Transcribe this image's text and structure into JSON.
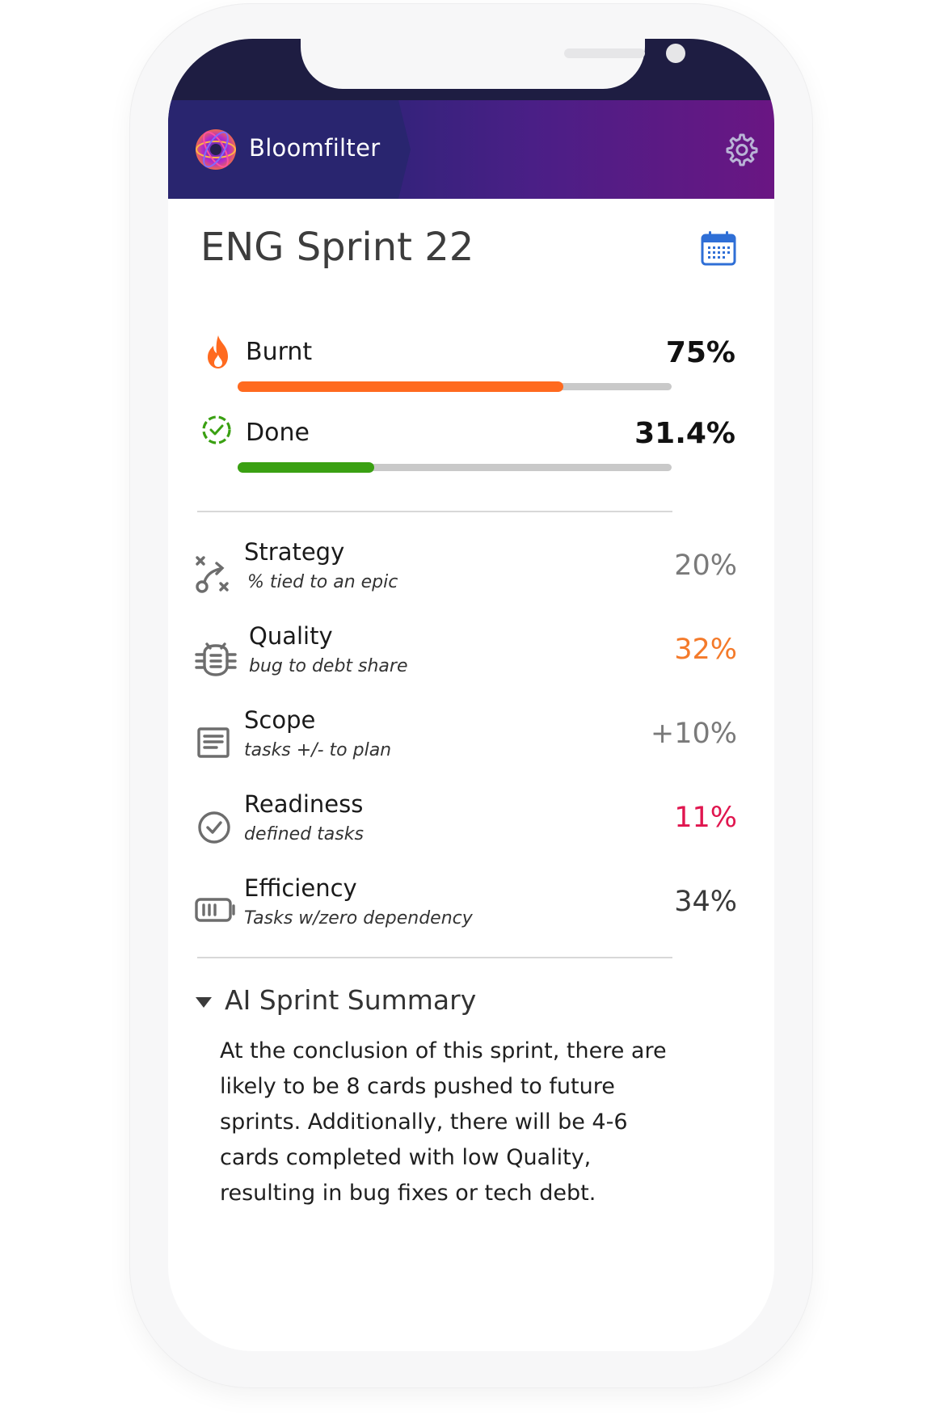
{
  "app": {
    "brand": "Bloomfilter"
  },
  "sprint": {
    "title": "ENG Sprint 22"
  },
  "progress": {
    "burnt": {
      "label": "Burnt",
      "value": "75%",
      "fraction": 0.75,
      "color": "#ff6a1f",
      "icon": "flame-icon"
    },
    "done": {
      "label": "Done",
      "value": "31.4%",
      "fraction": 0.314,
      "color": "#3aa012",
      "icon": "dashed-check-circle-icon"
    }
  },
  "metrics": [
    {
      "label": "Strategy",
      "sub": "% tied to an epic",
      "value": "20%",
      "color": "#7a7a7a",
      "icon": "strategy-icon"
    },
    {
      "label": "Quality",
      "sub": "bug to debt share",
      "value": "32%",
      "color": "#f47a2a",
      "icon": "bug-icon"
    },
    {
      "label": "Scope",
      "sub": "tasks +/- to plan",
      "value": "+10%",
      "color": "#7a7a7a",
      "icon": "document-icon"
    },
    {
      "label": "Readiness",
      "sub": "defined tasks",
      "value": "11%",
      "color": "#e0164f",
      "icon": "check-circle-icon"
    },
    {
      "label": "Efficiency",
      "sub": "Tasks w/zero dependency",
      "value": "34%",
      "color": "#3a3a3a",
      "icon": "battery-icon"
    }
  ],
  "summary": {
    "title": "AI Sprint Summary",
    "lines": [
      "At the conclusion of this sprint, there are",
      "likely to be 8 cards pushed to future",
      "sprints. Additionally, there will be 4-6",
      "cards completed with low Quality,",
      "resulting in bug fixes or tech debt."
    ]
  }
}
